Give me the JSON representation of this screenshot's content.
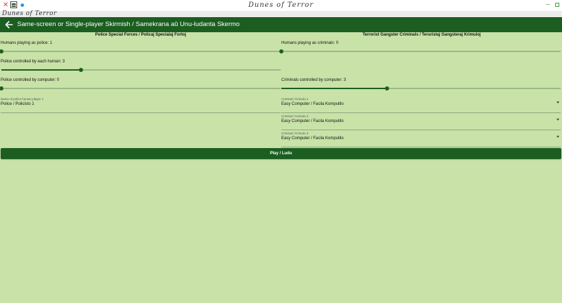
{
  "window": {
    "title": "Dunes of Terror",
    "app_name": "Dunes of Terror"
  },
  "appbar": {
    "title": "Same-screen or Single-player Skirmish / Samekrana aŭ Unu-ludanta Skermo",
    "back_icon": "arrow-left-icon"
  },
  "police": {
    "heading": "Police Special Forces / Policaj Specialaj Fortoj",
    "humans_label": "Humans playing as police: 1",
    "humans_value": 1,
    "per_human_label": "Police controlled by each human: 3",
    "per_human_value": 3,
    "computer_label": "Police controlled by computer: 0",
    "computer_value": 0,
    "players": [
      {
        "label": "Name of police human player 1",
        "value": "Police / Policisto 1"
      }
    ]
  },
  "criminals": {
    "heading": "Terrorist Gangster Criminals / Teruristaj Gangsteraj Krimuloj",
    "humans_label": "Humans playing as criminals: 0",
    "humans_value": 0,
    "computer_label": "Criminals controlled by computer: 3",
    "computer_value": 3,
    "slots": [
      {
        "label": "Criminal / Krimulo 1",
        "value": "Easy Computer / Facila Komputilo"
      },
      {
        "label": "Criminal / Krimulo 2",
        "value": "Easy Computer / Facila Komputilo"
      },
      {
        "label": "Criminal / Krimulo 3",
        "value": "Easy Computer / Facila Komputilo"
      }
    ]
  },
  "play_button": "Play / Ludu",
  "colors": {
    "primary": "#1b5e20",
    "background": "#c8e2a8"
  }
}
